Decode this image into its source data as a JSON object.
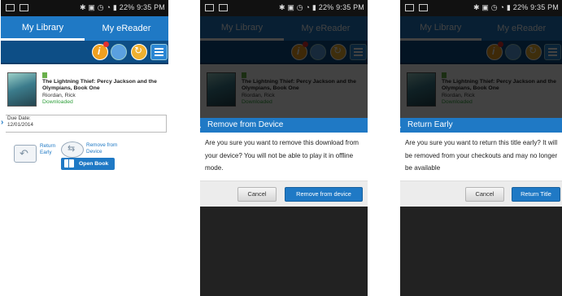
{
  "status": {
    "time": "9:35 PM",
    "battery": "22%"
  },
  "tabs": {
    "library": "My Library",
    "ereader": "My eReader"
  },
  "book": {
    "title": "The Lightning Thief: Percy Jackson and the Olympians, Book One",
    "author": "Riordan, Rick",
    "status": "Downloaded",
    "due_label": "Due Date:",
    "due_date": "12/01/2014"
  },
  "actions": {
    "return_early": "Return Early",
    "remove_from_device": "Remove from Device",
    "open_book": "Open Book"
  },
  "dialog_remove": {
    "title": "Remove from Device",
    "message": "Are you sure you want to remove this download from your device? You will not be able to play it in offline mode.",
    "cancel": "Cancel",
    "confirm": "Remove from device"
  },
  "dialog_return": {
    "title": "Return Early",
    "message": "Are you sure you want to return this title early? It will be removed from your checkouts and may no longer be available",
    "cancel": "Cancel",
    "confirm": "Return Title"
  },
  "colors": {
    "accent": "#1f79c5",
    "toolbar": "#0d4e86",
    "downloaded": "#2e9f3a"
  }
}
